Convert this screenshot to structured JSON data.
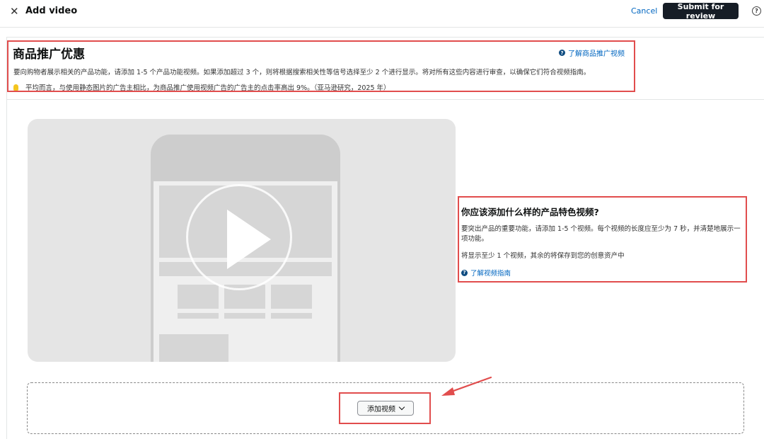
{
  "topbar": {
    "close_icon": "✕",
    "title": "Add video",
    "cancel_label": "Cancel",
    "submit_label": "Submit for review",
    "help_icon": "?"
  },
  "promo": {
    "title": "商品推广优惠",
    "link_label": "了解商品推广视频",
    "description": "要向购物者展示相关的产品功能，请添加 1-5 个产品功能视频。如果添加超过 3 个，则将根据搜索相关性等信号选择至少 2 个进行显示。将对所有这些内容进行审查，以确保它们符合视频指南。",
    "tip": "平均而言，与使用静态图片的广告主相比，为商品推广使用视频广告的广告主的点击率高出 9%。（亚马逊研究，2025 年）"
  },
  "info": {
    "title": "你应该添加什么样的产品特色视频?",
    "description": "要突出产品的重要功能，请添加 1-5 个视频。每个视频的长度应至少为 7 秒，并清楚地展示一项功能。",
    "note": "将显示至少 1 个视频，其余的将保存到您的创意资产中",
    "link_label": "了解视频指南"
  },
  "dropzone": {
    "add_label": "添加视频"
  },
  "colors": {
    "highlight": "#e14d4d",
    "link": "#0066c0",
    "primary_button": "#161d26"
  }
}
